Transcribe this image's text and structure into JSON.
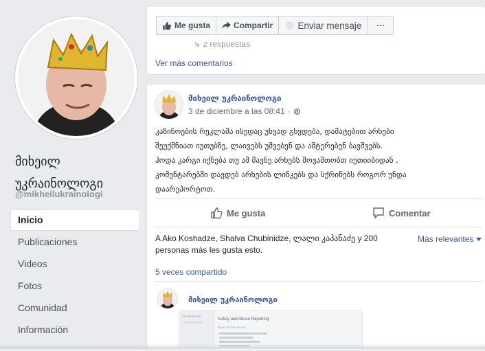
{
  "sidebar": {
    "page_name_line1": "მიხეილ",
    "page_name_line2": "უკრაინოლოგი",
    "username": "@mikheilukrainologi",
    "nav": [
      {
        "label": "Inicio",
        "active": true
      },
      {
        "label": "Publicaciones"
      },
      {
        "label": "Videos"
      },
      {
        "label": "Fotos"
      },
      {
        "label": "Comunidad"
      },
      {
        "label": "Información"
      }
    ]
  },
  "top_card": {
    "like_label": "Me gusta",
    "share_label": "Compartir",
    "message_label": "Enviar mensaje",
    "more_label": "···",
    "replies_text": "2 respuestas",
    "see_more_comments": "Ver más comentarios"
  },
  "post": {
    "author": "მიხეილ უკრაინოლოგი",
    "timestamp": "3 de diciembre a las 08:41",
    "privacy_icon": "globe-icon",
    "text_lines": [
      "კაზინოების რეკლამა ისედაც უხვად გხვდება, დამატებით არხები",
      "შეუქმნიათ იუთუბზე, ლაივებს უშვებენ და აშტერებენ ბავშვებს.",
      "ჰოდა კარგი იქნება თუ ამ მავნე არხებს მოვაშთობთ იუთიიბიდან .",
      "კომენტარებში დავდებ არხების ლინკებს და სქრინებს როგორ უნდა",
      "დაარეპორტოთ."
    ],
    "like_button": "Me gusta",
    "comment_button": "Comentar",
    "likes_text_line1": "A Ako Koshadze, Shalva Chubinidze, ლალი კაპანაძე y 200",
    "likes_text_line2": "personas más les gusta esto.",
    "most_relevant": "Más relevantes",
    "shares": "5 veces compartido"
  },
  "comment": {
    "author": "მიხეილ უკრაინოლოგი",
    "attachment_title": "Safety and Abuse Reporting",
    "attachment_sub": "WHAT IS THE ISSUE?",
    "attachment_side": "INFORMATION"
  },
  "colors": {
    "link": "#385898",
    "background": "#e9ebee",
    "card": "#ffffff",
    "crown": "#e0b530"
  }
}
